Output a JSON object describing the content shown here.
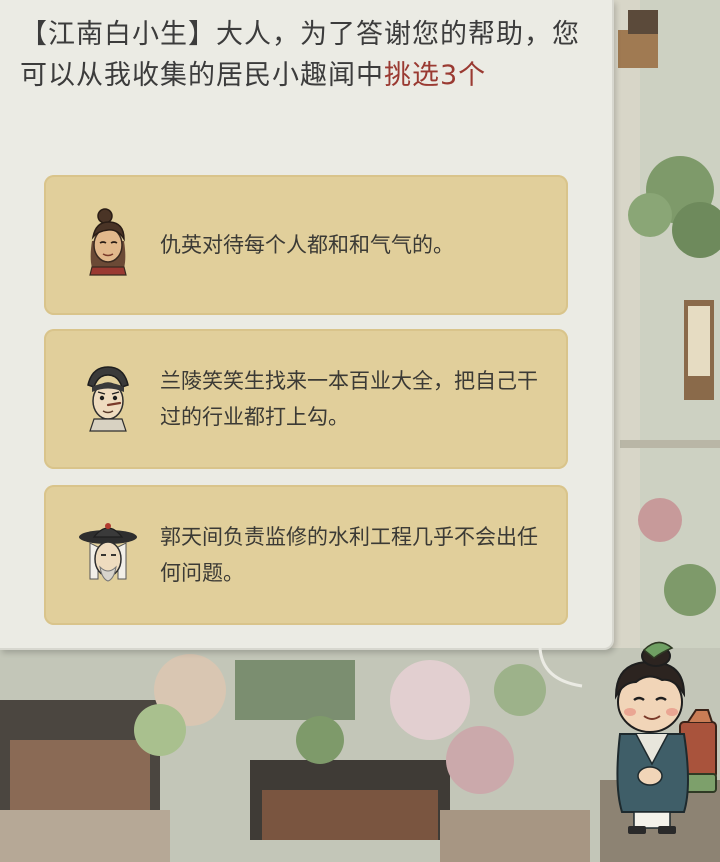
{
  "dialog": {
    "prefix": "【江南白小生】大人，为了答谢您的帮助，您可以从我收集的居民小趣闻中",
    "highlight": "挑选3个",
    "highlight_color": "#9a3a32"
  },
  "options": [
    {
      "text": "仇英对待每个人都和和气气的。",
      "portrait": "qiu-ying-portrait-icon"
    },
    {
      "text": "兰陵笑笑生找来一本百业大全，把自己干过的行业都打上勾。",
      "portrait": "lanling-portrait-icon"
    },
    {
      "text": "郭天间负责监修的水利工程几乎不会出任何问题。",
      "portrait": "guo-tianjian-portrait-icon"
    }
  ],
  "colors": {
    "panel": "#ebebe4",
    "option_card": "#e1cf9b",
    "text": "#3b3a35"
  },
  "guide": {
    "icon": "scholar-guide-icon"
  }
}
